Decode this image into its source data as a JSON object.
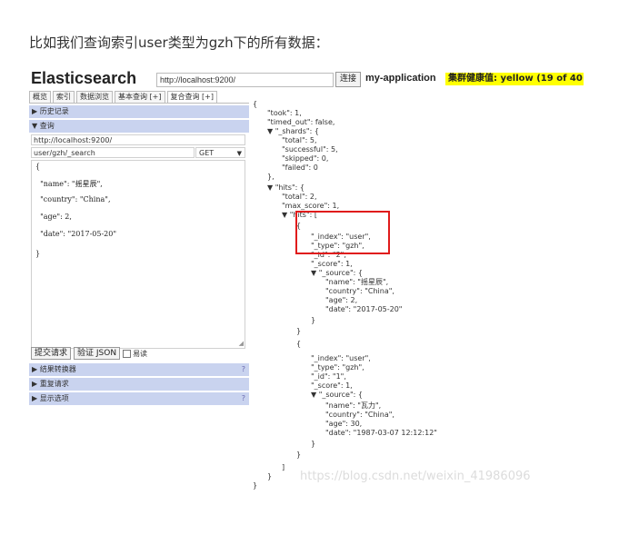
{
  "intro": "比如我们查询索引user类型为gzh下的所有数据：",
  "header": {
    "brand": "Elasticsearch",
    "url": "http://localhost:9200/",
    "connect": "连接",
    "cluster_name": "my-application",
    "health": "集群健康值: yellow (19 of 40"
  },
  "tabs": [
    "概览",
    "索引",
    "数据浏览",
    "基本查询 [+]",
    "复合查询 [+]"
  ],
  "left": {
    "history": "▶ 历史记录",
    "query": "▼ 查询",
    "server_url": "http://localhost:9200/",
    "path": "user/gzh/_search",
    "method": "GET",
    "body_lines": [
      "{",
      "  \"name\": \"摇星辰\",",
      "  \"country\": \"China\",",
      "  \"age\": 2,",
      "  \"date\": \"2017-05-20\"",
      "}"
    ],
    "submit": "提交请求",
    "validate": "验证 JSON",
    "pretty": "易读",
    "transformer": "▶ 结果转换器",
    "repeat": "▶ 重复请求",
    "display": "▶ 显示选项",
    "help": "?"
  },
  "json_lines": [
    "{",
    "\"took\": 1,",
    "\"timed_out\": false,",
    "▼ \"_shards\": {",
    "\"total\": 5,",
    "\"successful\": 5,",
    "\"skipped\": 0,",
    "\"failed\": 0",
    "},",
    "▼ \"hits\": {",
    "\"total\": 2,",
    "\"max_score\": 1,",
    "▼ \"hits\": [",
    "{",
    "\"_index\": \"user\",",
    "\"_type\": \"gzh\",",
    "\"_id\": \"2\",",
    "\"_score\": 1,",
    "▼ \"_source\": {",
    "\"name\": \"摇星辰\",",
    "\"country\": \"China\",",
    "\"age\": 2,",
    "\"date\": \"2017-05-20\"",
    "}",
    "}",
    "{",
    "\"_index\": \"user\",",
    "\"_type\": \"gzh\",",
    "\"_id\": \"1\",",
    "\"_score\": 1,",
    "▼ \"_source\": {",
    "\"name\": \"瓦力\",",
    "\"country\": \"China\",",
    "\"age\": 30,",
    "\"date\": \"1987-03-07 12:12:12\"",
    "}",
    "}",
    "]",
    "}",
    "}"
  ],
  "watermark": "https://blog.csdn.net/weixin_41986096",
  "colors": {
    "health": "#ffff00",
    "bar": "#c9d3ef",
    "highlight": "#e01b1b"
  }
}
